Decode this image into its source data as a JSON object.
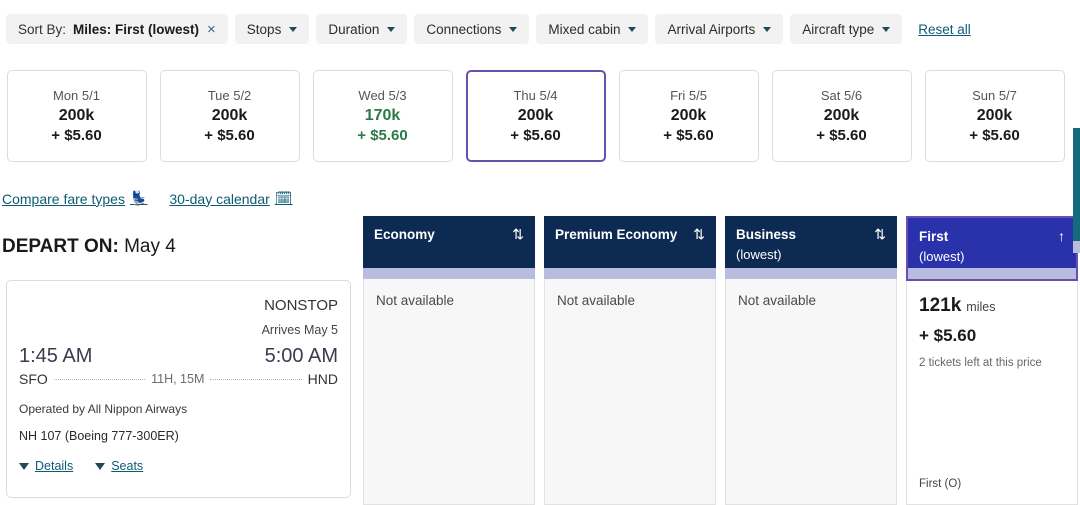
{
  "filters": {
    "sort_chip": {
      "prefix": "Sort By:",
      "value": "Miles: First (lowest)",
      "close_icon": "×"
    },
    "chips": [
      {
        "label": "Stops",
        "icon": "chevron-down-icon"
      },
      {
        "label": "Duration",
        "icon": "chevron-down-icon"
      },
      {
        "label": "Connections",
        "icon": "chevron-down-icon"
      },
      {
        "label": "Mixed cabin",
        "icon": "chevron-down-icon"
      },
      {
        "label": "Arrival Airports",
        "icon": "chevron-down-icon"
      },
      {
        "label": "Aircraft type",
        "icon": "chevron-down-icon"
      }
    ],
    "reset_all": "Reset all"
  },
  "date_strip": [
    {
      "dow": "Mon 5/1",
      "miles": "200k",
      "cash": "+ $5.60",
      "selected": false,
      "lowest": false
    },
    {
      "dow": "Tue 5/2",
      "miles": "200k",
      "cash": "+ $5.60",
      "selected": false,
      "lowest": false
    },
    {
      "dow": "Wed 5/3",
      "miles": "170k",
      "cash": "+ $5.60",
      "selected": false,
      "lowest": true
    },
    {
      "dow": "Thu 5/4",
      "miles": "200k",
      "cash": "+ $5.60",
      "selected": true,
      "lowest": false
    },
    {
      "dow": "Fri 5/5",
      "miles": "200k",
      "cash": "+ $5.60",
      "selected": false,
      "lowest": false
    },
    {
      "dow": "Sat 5/6",
      "miles": "200k",
      "cash": "+ $5.60",
      "selected": false,
      "lowest": false
    },
    {
      "dow": "Sun 5/7",
      "miles": "200k",
      "cash": "+ $5.60",
      "selected": false,
      "lowest": false
    }
  ],
  "links": {
    "compare_fare_types": "Compare fare types",
    "compare_icon": "💺",
    "calendar_link": "30-day calendar",
    "calendar_icon": "🗓"
  },
  "depart": {
    "label": "DEPART ON:",
    "date": "May 4"
  },
  "flight": {
    "stops": "NONSTOP",
    "arrives": "Arrives May 5",
    "depart_time": "1:45 AM",
    "arrive_time": "5:00 AM",
    "origin": "SFO",
    "destination": "HND",
    "duration": "11H, 15M",
    "operated_by": "Operated by All Nippon Airways",
    "flight_number": "NH 107 (Boeing 777-300ER)",
    "details_label": "Details",
    "seats_label": "Seats"
  },
  "fare_columns": [
    {
      "name": "Economy",
      "sub": "",
      "sort_icon": "⇅",
      "active": false,
      "status": "Not available",
      "miles": "",
      "miles_unit": "",
      "cash": "",
      "tickets_left": "",
      "fare_class": ""
    },
    {
      "name": "Premium Economy",
      "sub": "",
      "sort_icon": "⇅",
      "active": false,
      "status": "Not available",
      "miles": "",
      "miles_unit": "",
      "cash": "",
      "tickets_left": "",
      "fare_class": ""
    },
    {
      "name": "Business",
      "sub": "(lowest)",
      "sort_icon": "⇅",
      "active": false,
      "status": "Not available",
      "miles": "",
      "miles_unit": "",
      "cash": "",
      "tickets_left": "",
      "fare_class": ""
    },
    {
      "name": "First",
      "sub": "(lowest)",
      "sort_icon": "↑",
      "active": true,
      "status": "",
      "miles": "121k",
      "miles_unit": "miles",
      "cash": "+ $5.60",
      "tickets_left": "2 tickets left at this price",
      "fare_class": "First (O)"
    }
  ],
  "colors": {
    "header_navy": "#0d2a52",
    "selected_blue": "#2a32ab",
    "selected_purple_border": "#6a4fb3",
    "accent_lavender": "#b8bde0",
    "link_teal": "#0d5c75",
    "lowest_green": "#2a7a48"
  }
}
